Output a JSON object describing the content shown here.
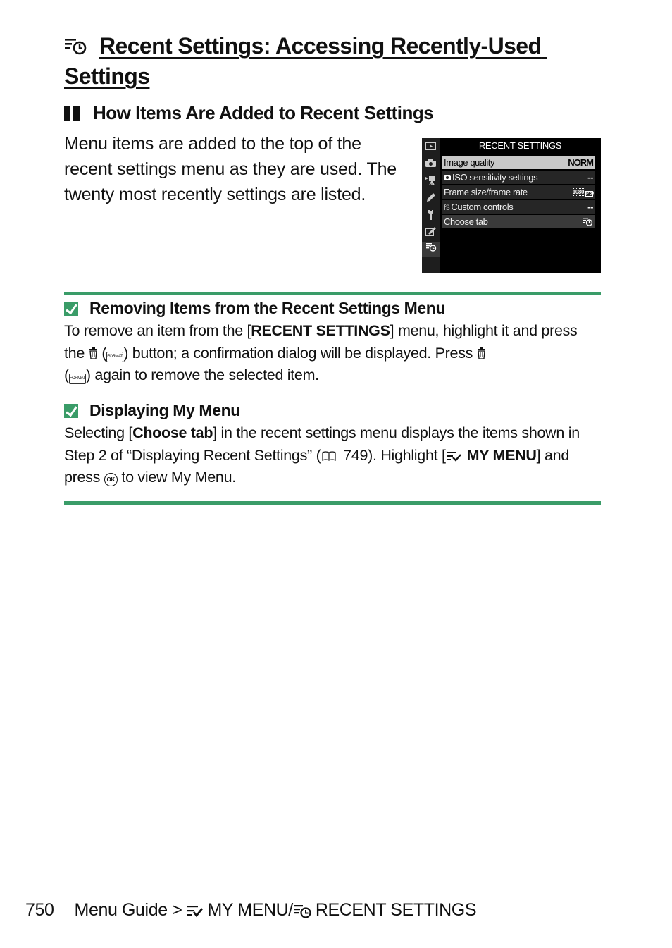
{
  "page": {
    "title_line1": "Recent Settings: Accessing Recently-Used",
    "title_line2": "Settings",
    "title_icon": "recent-settings-icon",
    "section_heading": "How Items Are Added to Recent Settings",
    "intro_text": "Menu items are added to the top of the recent settings menu as they are used. The twenty most recently settings are listed."
  },
  "camera_screen": {
    "header": "RECENT SETTINGS",
    "rail_icons": [
      "playback-icon",
      "photo-shooting-icon",
      "movie-shooting-icon",
      "custom-settings-icon",
      "setup-icon",
      "retouch-icon",
      "recent-settings-icon"
    ],
    "active_rail_icon": "recent-settings-icon",
    "items": [
      {
        "label": "Image quality",
        "value": "NORM",
        "selected": true
      },
      {
        "prefix_icon": "camera-icon",
        "label": "ISO sensitivity settings",
        "value": "--",
        "selected": false
      },
      {
        "label": "Frame size/frame rate",
        "value": "1080",
        "value_badge": "P 60",
        "selected": false
      },
      {
        "prefix": "f3",
        "label": "Custom controls",
        "value": "--",
        "selected": false
      },
      {
        "label": "Choose tab",
        "value_icon": "recent-settings-icon",
        "selected": false
      }
    ]
  },
  "notes": [
    {
      "icon": "checkmark-icon",
      "heading": "Removing Items from the Recent Settings Menu",
      "body": {
        "t1": "To remove an item from the [",
        "b1": "RECENT SETTINGS",
        "t2": "] menu, highlight it and press the ",
        "t3": " (",
        "t4": ") button; a confirmation dialog will be displayed. Press ",
        "t5": " (",
        "t6": ") again to remove the selected item.",
        "format_label": "FORMAT"
      }
    },
    {
      "icon": "checkmark-icon",
      "heading": "Displaying My Menu",
      "body": {
        "t1": "Selecting [",
        "b1": "Choose tab",
        "t2": "] in the recent settings menu displays the items shown in Step 2 of “Displaying Recent Settings” (",
        "page_ref": "749",
        "t3": "). Highlight [",
        "b2": "MY MENU",
        "t4": "] and press ",
        "ok_label": "OK",
        "t5": " to view My Menu."
      }
    }
  ],
  "footer": {
    "page_number": "750",
    "crumb1": "Menu Guide > ",
    "crumb2": "MY MENU/",
    "crumb3": "RECENT SETTINGS"
  },
  "colors": {
    "accent_green": "#3a9c68"
  }
}
